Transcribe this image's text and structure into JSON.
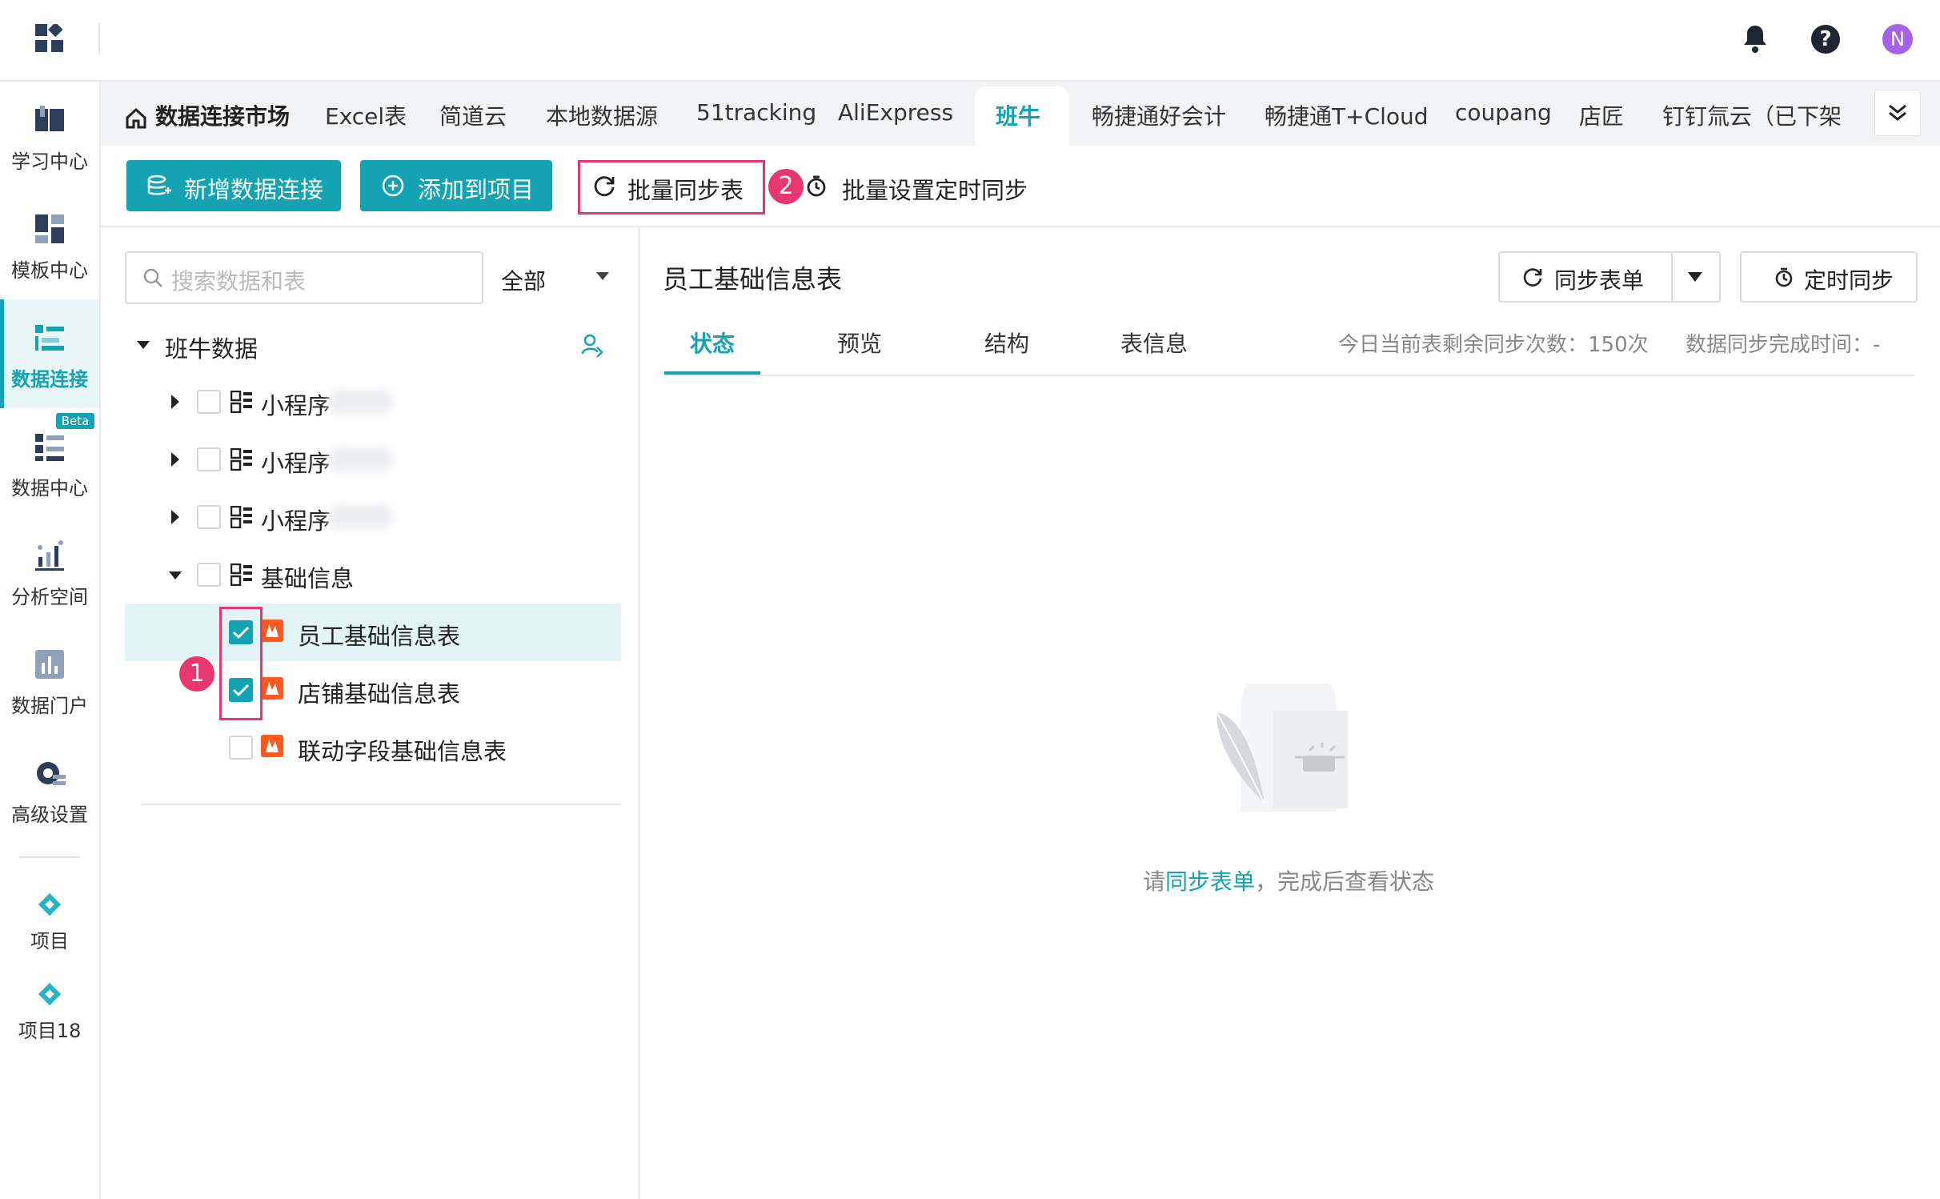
{
  "sidebar": {
    "items": [
      {
        "label": "学习中心",
        "icon": "learning-center-icon"
      },
      {
        "label": "模板中心",
        "icon": "template-center-icon"
      },
      {
        "label": "数据连接",
        "icon": "data-connection-icon",
        "active": true
      },
      {
        "label": "数据中心",
        "icon": "data-center-icon",
        "badge": "Beta"
      },
      {
        "label": "分析空间",
        "icon": "analysis-space-icon"
      },
      {
        "label": "数据门户",
        "icon": "data-portal-icon"
      },
      {
        "label": "高级设置",
        "icon": "advanced-settings-icon"
      },
      {
        "label": "项目",
        "icon": "project-icon"
      },
      {
        "label": "项目18",
        "icon": "project-icon"
      }
    ]
  },
  "header": {
    "avatar_letter": "N"
  },
  "tabs": [
    "数据连接市场",
    "Excel表",
    "简道云",
    "本地数据源",
    "51tracking",
    "AliExpress",
    "班牛",
    "畅捷通好会计",
    "畅捷通T+Cloud",
    "coupang",
    "店匠",
    "钉钉氚云（已下架"
  ],
  "toolbar": {
    "add_connection": "新增数据连接",
    "add_to_project": "添加到项目",
    "batch_sync": "批量同步表",
    "batch_schedule": "批量设置定时同步"
  },
  "annotations": {
    "one": "1",
    "two": "2"
  },
  "search": {
    "placeholder": "搜索数据和表",
    "filter": "全部"
  },
  "tree": {
    "root": "班牛数据",
    "groups": [
      {
        "label": "小程序"
      },
      {
        "label": "小程序"
      },
      {
        "label": "小程序"
      },
      {
        "label": "基础信息"
      }
    ],
    "tables": [
      {
        "label": "员工基础信息表",
        "checked": true
      },
      {
        "label": "店铺基础信息表",
        "checked": true
      },
      {
        "label": "联动字段基础信息表",
        "checked": false
      }
    ]
  },
  "detail": {
    "title": "员工基础信息表",
    "sync_button": "同步表单",
    "schedule_button": "定时同步",
    "subtabs": [
      "状态",
      "预览",
      "结构",
      "表信息"
    ],
    "remaining_info": "今日当前表剩余同步次数：150次",
    "completion_info": "数据同步完成时间：-",
    "empty_prefix": "请",
    "empty_link": "同步表单",
    "empty_suffix": "，完成后查看状态"
  },
  "colors": {
    "accent": "#13a3b3",
    "highlight": "#e8366f"
  }
}
